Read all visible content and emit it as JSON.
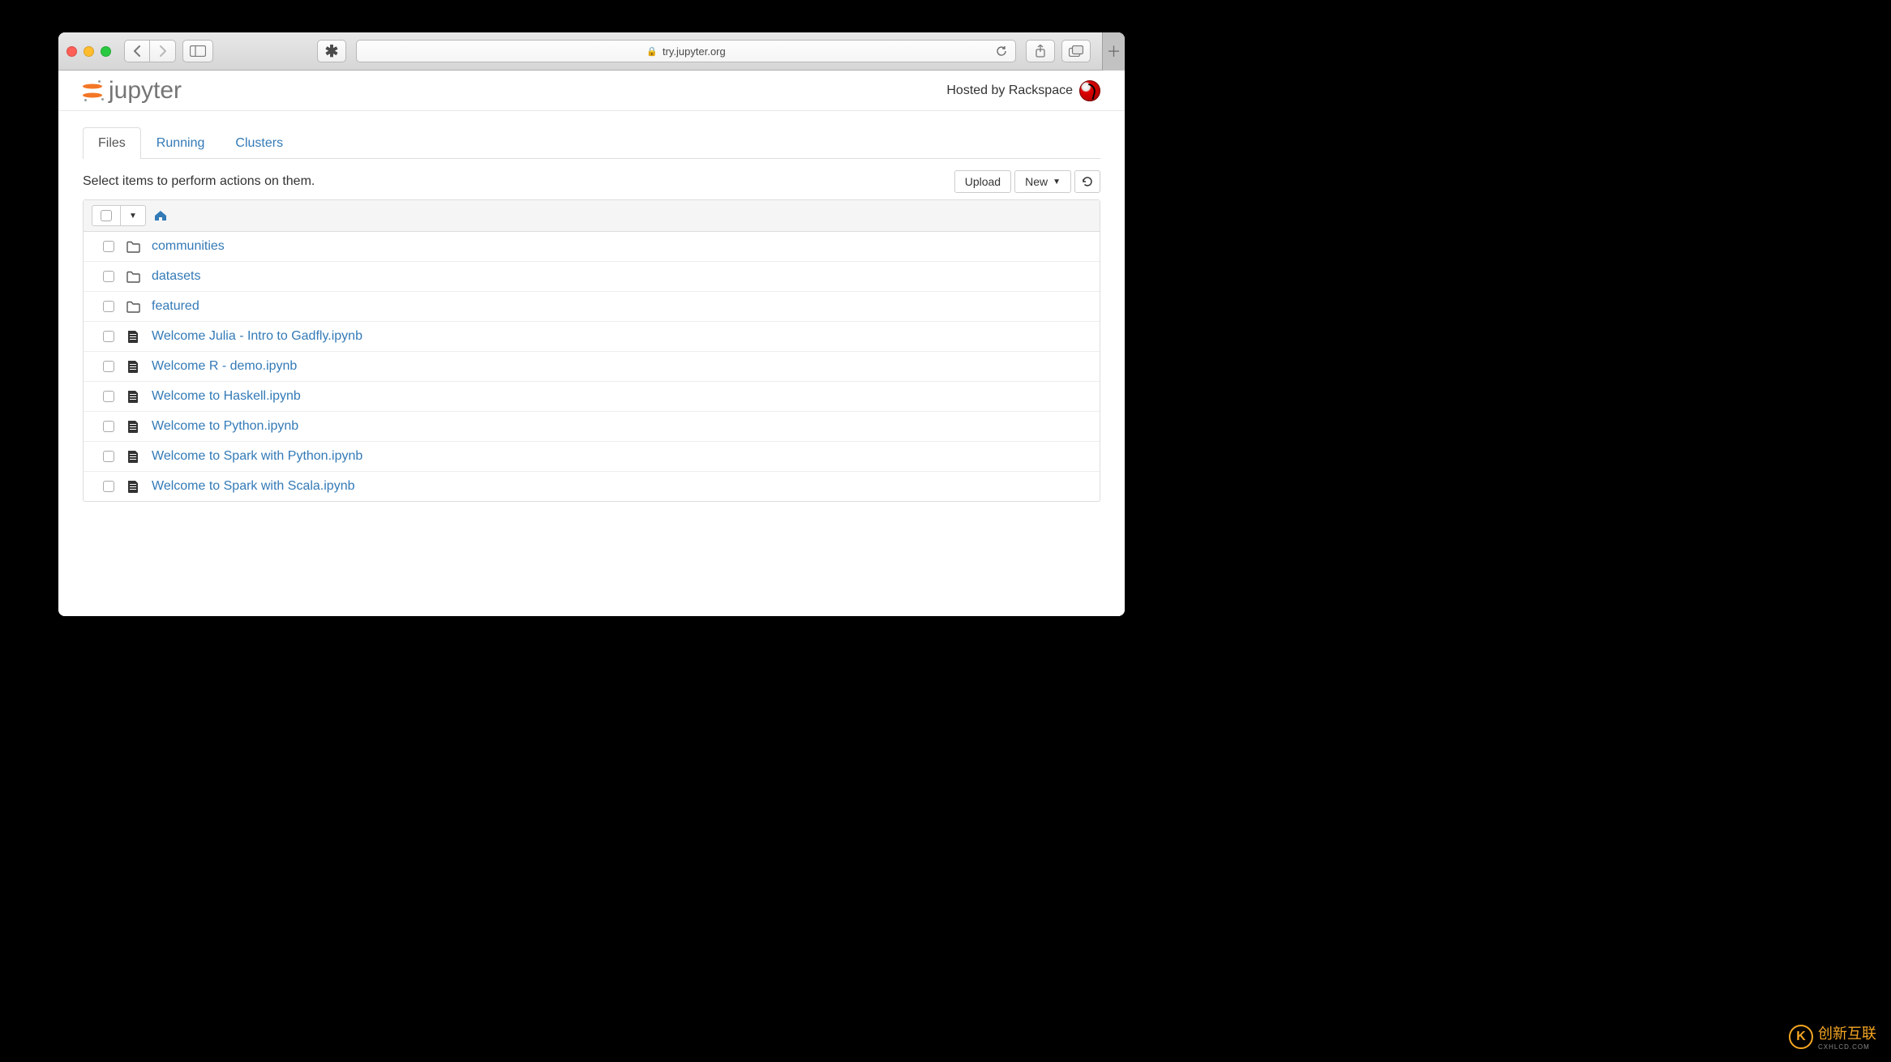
{
  "browser": {
    "url": "try.jupyter.org"
  },
  "header": {
    "logo_text": "jupyter",
    "hosted_by": "Hosted by Rackspace"
  },
  "tabs": {
    "files": "Files",
    "running": "Running",
    "clusters": "Clusters",
    "active": "files"
  },
  "actions": {
    "hint": "Select items to perform actions on them.",
    "upload": "Upload",
    "new": "New"
  },
  "files": [
    {
      "type": "folder",
      "name": "communities"
    },
    {
      "type": "folder",
      "name": "datasets"
    },
    {
      "type": "folder",
      "name": "featured"
    },
    {
      "type": "notebook",
      "name": "Welcome Julia - Intro to Gadfly.ipynb"
    },
    {
      "type": "notebook",
      "name": "Welcome R - demo.ipynb"
    },
    {
      "type": "notebook",
      "name": "Welcome to Haskell.ipynb"
    },
    {
      "type": "notebook",
      "name": "Welcome to Python.ipynb"
    },
    {
      "type": "notebook",
      "name": "Welcome to Spark with Python.ipynb"
    },
    {
      "type": "notebook",
      "name": "Welcome to Spark with Scala.ipynb"
    }
  ],
  "watermark": {
    "main": "创新互联",
    "sub": "CXHLCD.COM"
  }
}
